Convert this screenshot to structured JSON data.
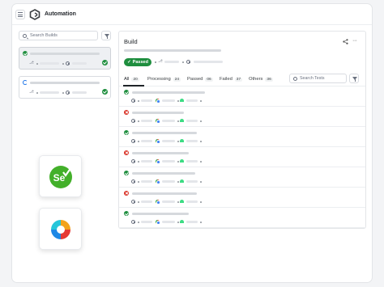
{
  "app": {
    "title": "Automation"
  },
  "sidebar": {
    "search_placeholder": "Search Builds"
  },
  "main": {
    "title": "Build",
    "status_label": "Passed",
    "tabs": [
      {
        "label": "All",
        "count": "20"
      },
      {
        "label": "Processing",
        "count": "24"
      },
      {
        "label": "Passed",
        "count": "06"
      },
      {
        "label": "Failed",
        "count": "37"
      },
      {
        "label": "Others",
        "count": "36"
      }
    ],
    "tests_search_placeholder": "Search Tests",
    "test_rows": [
      {
        "status": "passed"
      },
      {
        "status": "failed"
      },
      {
        "status": "passed"
      },
      {
        "status": "failed"
      },
      {
        "status": "passed"
      },
      {
        "status": "failed"
      },
      {
        "status": "passed"
      }
    ]
  },
  "logos": [
    {
      "name": "selenium-logo",
      "text": "Se"
    },
    {
      "name": "katalon-logo"
    }
  ],
  "colors": {
    "success": "#1e8e3e",
    "failure": "#d93025",
    "processing": "#1a73e8",
    "selenium": "#43b02a"
  }
}
